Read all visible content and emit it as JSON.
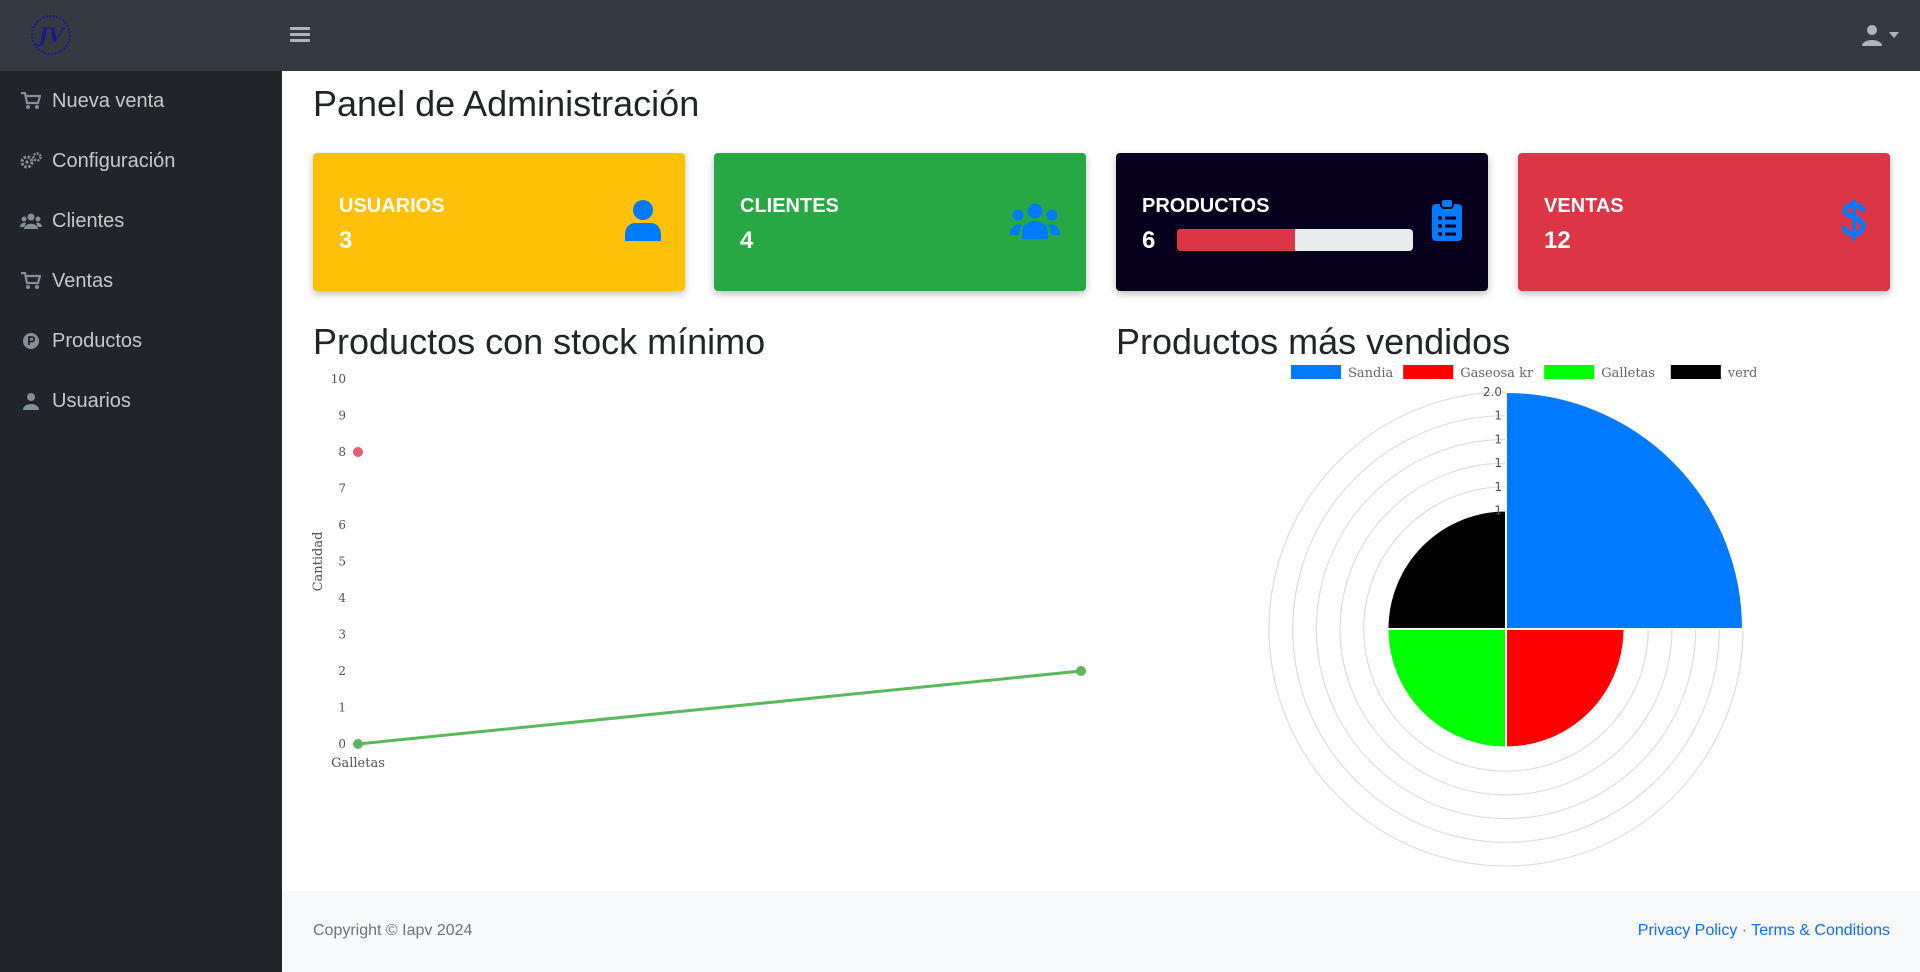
{
  "header": {
    "logo_text": "JV"
  },
  "sidebar": {
    "items": [
      {
        "label": "Nueva venta",
        "icon": "cart-icon"
      },
      {
        "label": "Configuración",
        "icon": "gears-icon"
      },
      {
        "label": "Clientes",
        "icon": "users-icon"
      },
      {
        "label": "Ventas",
        "icon": "cart-icon"
      },
      {
        "label": "Productos",
        "icon": "product-hunt-icon"
      },
      {
        "label": "Usuarios",
        "icon": "user-icon"
      }
    ]
  },
  "main": {
    "title": "Panel de Administración",
    "cards": [
      {
        "title": "USUARIOS",
        "value": "3",
        "color": "#ffc107",
        "icon": "user-icon"
      },
      {
        "title": "CLIENTES",
        "value": "4",
        "color": "#28a745",
        "icon": "users-icon"
      },
      {
        "title": "PRODUCTOS",
        "value": "6",
        "color": "#06001d",
        "icon": "clipboard-list-icon",
        "progress_fraction": 0.5
      },
      {
        "title": "VENTAS",
        "value": "12",
        "color": "#dc3545",
        "icon": "dollar-icon"
      }
    ],
    "stock_title": "Productos con stock mínimo",
    "sales_title": "Productos más vendidos"
  },
  "chart_data": [
    {
      "type": "line",
      "title": "",
      "xlabel": "",
      "ylabel": "Cantidad",
      "categories": [
        "Galletas",
        ""
      ],
      "ylim": [
        0,
        10
      ],
      "yticks": [
        "0",
        "1",
        "2",
        "3",
        "4",
        "5",
        "6",
        "7",
        "8",
        "9",
        "10"
      ],
      "series": [
        {
          "values": [
            0,
            2
          ],
          "color": "#5cb85c"
        },
        {
          "values": [
            8
          ],
          "color": "#e06070"
        }
      ]
    },
    {
      "type": "pie",
      "subtype": "polar-area",
      "title": "",
      "legend": [
        "Sandia",
        "Gaseosa kr",
        "Galletas",
        "verde"
      ],
      "legend_placement": "top",
      "values": [
        2,
        1,
        1,
        1
      ],
      "colors": [
        "#007bff",
        "#ff0000",
        "#00ff00",
        "#000000"
      ],
      "tick_labels": [
        "1",
        "1",
        "1",
        "1",
        "1",
        "2.0"
      ],
      "grid": true
    }
  ],
  "footer": {
    "copyright": "Copyright © Iapv 2024",
    "privacy": "Privacy Policy",
    "separator": "·",
    "terms": "Terms & Conditions"
  },
  "colors": {
    "topbar": "#343a40",
    "sidebar": "#212529",
    "link": "#0d6efd",
    "icon_blue": "#007bff"
  }
}
